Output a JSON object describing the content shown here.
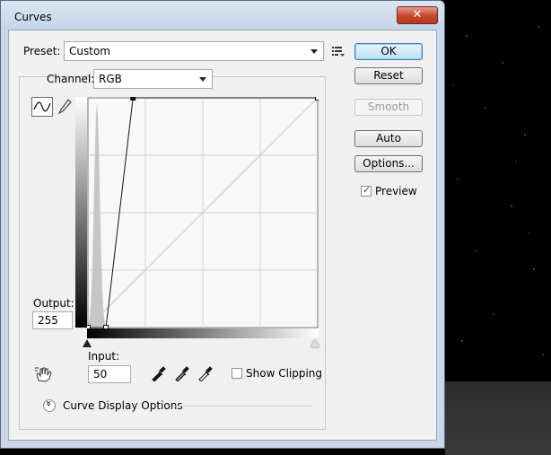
{
  "window": {
    "title": "Curves",
    "close_glyph": "✕"
  },
  "preset": {
    "label": "Preset:",
    "value": "Custom"
  },
  "channel": {
    "label": "Channel:",
    "value": "RGB"
  },
  "buttons": {
    "ok": "OK",
    "reset": "Reset",
    "smooth": "Smooth",
    "auto": "Auto",
    "options": "Options..."
  },
  "preview": {
    "label": "Preview",
    "checked": true
  },
  "output": {
    "label": "Output:",
    "value": "255"
  },
  "input": {
    "label": "Input:",
    "value": "50"
  },
  "show_clipping": {
    "label": "Show Clipping",
    "checked": false
  },
  "curve_display": {
    "label": "Curve Display Options"
  },
  "curve": {
    "points": [
      [
        0,
        0
      ],
      [
        20,
        0
      ],
      [
        50,
        255
      ],
      [
        255,
        255
      ]
    ],
    "grid_divisions": 4
  },
  "colors": {
    "accent": "#3c7fb1",
    "dialog_frame": "#c9d7e8",
    "client_bg": "#f0f0f0"
  },
  "icons": [
    "curve-tool-icon",
    "pencil-icon",
    "hand-icon",
    "presets-menu-icon",
    "black-eyedropper-icon",
    "gray-eyedropper-icon",
    "white-eyedropper-icon",
    "expand-icon",
    "close-icon"
  ]
}
